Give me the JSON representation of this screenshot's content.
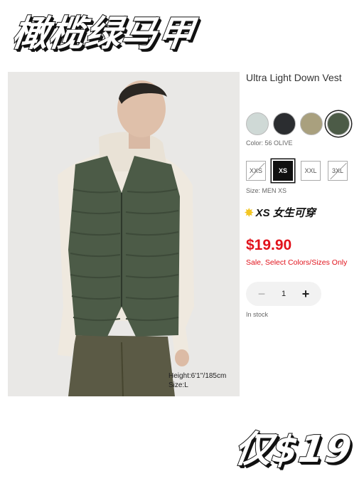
{
  "headline": "橄榄绿马甲",
  "product": {
    "title": "Ultra Light Down Vest",
    "color_label": "Color: 56 OLIVE",
    "swatches": [
      {
        "name": "light-mint",
        "color": "#cfd9d6",
        "selected": false
      },
      {
        "name": "black",
        "color": "#2b2d30",
        "selected": false
      },
      {
        "name": "beige",
        "color": "#a9a07e",
        "selected": false
      },
      {
        "name": "olive",
        "color": "#4c5b47",
        "selected": true
      }
    ],
    "sizes": [
      {
        "label": "XXS",
        "available": false,
        "selected": false
      },
      {
        "label": "XS",
        "available": true,
        "selected": true
      },
      {
        "label": "XXL",
        "available": true,
        "selected": false
      },
      {
        "label": "3XL",
        "available": false,
        "selected": false
      }
    ],
    "size_label": "Size: MEN XS",
    "promo_text": "XS 女生可穿",
    "price": "$19.90",
    "sale_note": "Sale,  Select Colors/Sizes Only",
    "quantity": "1",
    "stock": "In stock",
    "model_height": "Height:6'1''/185cm",
    "model_size": "Size:L"
  },
  "price_sticker": "仅$19",
  "colors": {
    "sale_red": "#e1121b",
    "vest_olive": "#4c5b47",
    "photo_bg": "#e9e8e6"
  },
  "icons": {
    "minus": "minus-icon",
    "plus": "plus-icon",
    "star": "sparkle-icon"
  }
}
